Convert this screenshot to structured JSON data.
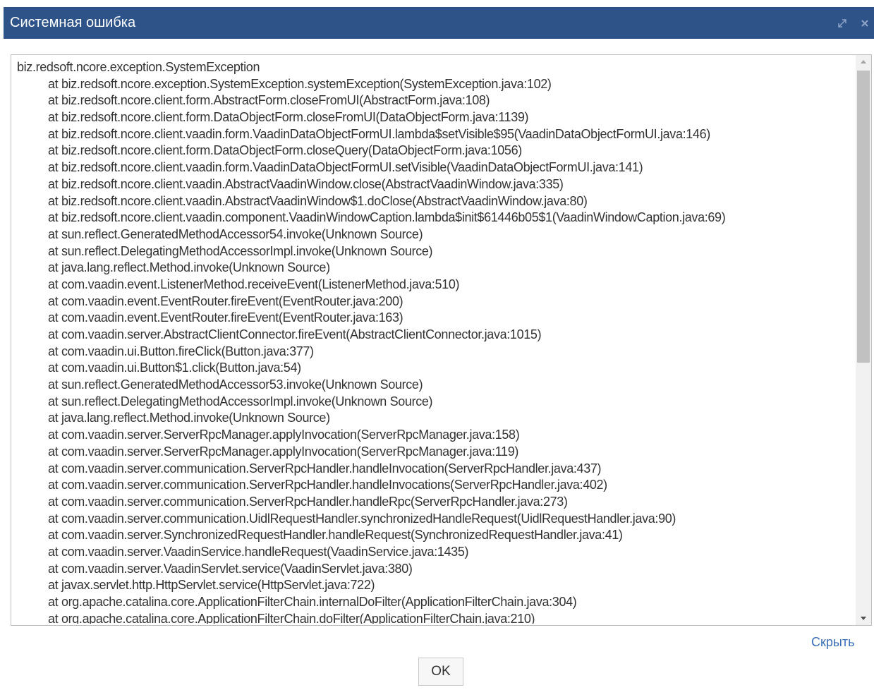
{
  "dialog": {
    "title": "Системная ошибка",
    "colors": {
      "titlebar": "#2e5389",
      "link": "#3a6fb7"
    },
    "window_controls": [
      {
        "name": "maximize",
        "icon": "maximize-icon"
      },
      {
        "name": "close",
        "icon": "close-icon"
      }
    ]
  },
  "trace": {
    "lines": [
      "biz.redsoft.ncore.exception.SystemException",
      "at biz.redsoft.ncore.exception.SystemException.systemException(SystemException.java:102)",
      "at biz.redsoft.ncore.client.form.AbstractForm.closeFromUI(AbstractForm.java:108)",
      "at biz.redsoft.ncore.client.form.DataObjectForm.closeFromUI(DataObjectForm.java:1139)",
      "at biz.redsoft.ncore.client.vaadin.form.VaadinDataObjectFormUI.lambda$setVisible$95(VaadinDataObjectFormUI.java:146)",
      "at biz.redsoft.ncore.client.form.DataObjectForm.closeQuery(DataObjectForm.java:1056)",
      "at biz.redsoft.ncore.client.vaadin.form.VaadinDataObjectFormUI.setVisible(VaadinDataObjectFormUI.java:141)",
      "at biz.redsoft.ncore.client.vaadin.AbstractVaadinWindow.close(AbstractVaadinWindow.java:335)",
      "at biz.redsoft.ncore.client.vaadin.AbstractVaadinWindow$1.doClose(AbstractVaadinWindow.java:80)",
      "at biz.redsoft.ncore.client.vaadin.component.VaadinWindowCaption.lambda$init$61446b05$1(VaadinWindowCaption.java:69)",
      "at sun.reflect.GeneratedMethodAccessor54.invoke(Unknown Source)",
      "at sun.reflect.DelegatingMethodAccessorImpl.invoke(Unknown Source)",
      "at java.lang.reflect.Method.invoke(Unknown Source)",
      "at com.vaadin.event.ListenerMethod.receiveEvent(ListenerMethod.java:510)",
      "at com.vaadin.event.EventRouter.fireEvent(EventRouter.java:200)",
      "at com.vaadin.event.EventRouter.fireEvent(EventRouter.java:163)",
      "at com.vaadin.server.AbstractClientConnector.fireEvent(AbstractClientConnector.java:1015)",
      "at com.vaadin.ui.Button.fireClick(Button.java:377)",
      "at com.vaadin.ui.Button$1.click(Button.java:54)",
      "at sun.reflect.GeneratedMethodAccessor53.invoke(Unknown Source)",
      "at sun.reflect.DelegatingMethodAccessorImpl.invoke(Unknown Source)",
      "at java.lang.reflect.Method.invoke(Unknown Source)",
      "at com.vaadin.server.ServerRpcManager.applyInvocation(ServerRpcManager.java:158)",
      "at com.vaadin.server.ServerRpcManager.applyInvocation(ServerRpcManager.java:119)",
      "at com.vaadin.server.communication.ServerRpcHandler.handleInvocation(ServerRpcHandler.java:437)",
      "at com.vaadin.server.communication.ServerRpcHandler.handleInvocations(ServerRpcHandler.java:402)",
      "at com.vaadin.server.communication.ServerRpcHandler.handleRpc(ServerRpcHandler.java:273)",
      "at com.vaadin.server.communication.UidlRequestHandler.synchronizedHandleRequest(UidlRequestHandler.java:90)",
      "at com.vaadin.server.SynchronizedRequestHandler.handleRequest(SynchronizedRequestHandler.java:41)",
      "at com.vaadin.server.VaadinService.handleRequest(VaadinService.java:1435)",
      "at com.vaadin.server.VaadinServlet.service(VaadinServlet.java:380)",
      "at javax.servlet.http.HttpServlet.service(HttpServlet.java:722)",
      "at org.apache.catalina.core.ApplicationFilterChain.internalDoFilter(ApplicationFilterChain.java:304)",
      "at org.apache.catalina.core.ApplicationFilterChain.doFilter(ApplicationFilterChain.java:210)"
    ]
  },
  "actions": {
    "hide_label": "Скрыть",
    "ok_label": "OK"
  }
}
